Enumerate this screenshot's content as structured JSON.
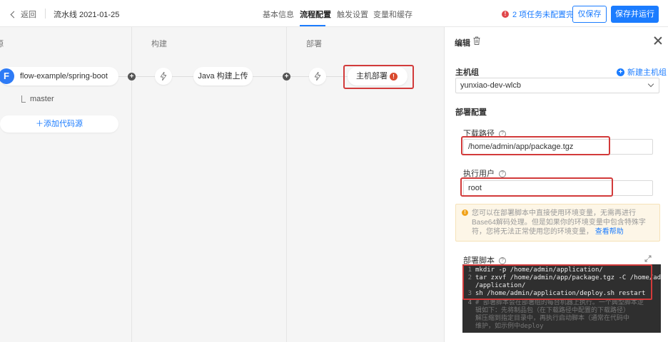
{
  "header": {
    "back_label": "返回",
    "pipeline_title": "流水线 2021-01-25",
    "tabs": [
      {
        "label": "基本信息",
        "active": false
      },
      {
        "label": "流程配置",
        "active": true
      },
      {
        "label": "触发设置",
        "active": false
      },
      {
        "label": "变量和缓存",
        "active": false
      }
    ],
    "warning_count": "!",
    "warning_text": "2 项任务未配置完",
    "save_label": "仅保存",
    "save_run_label": "保存并运行"
  },
  "canvas": {
    "stages": [
      {
        "label": "源"
      },
      {
        "label": "构建"
      },
      {
        "label": "部署"
      }
    ],
    "source": {
      "icon": "F",
      "repo": "flow-example/spring-boot",
      "branch": "master",
      "add_label": "＋添加代码源"
    },
    "build_task": "Java 构建上传",
    "deploy_task": "主机部署",
    "deploy_error": "!"
  },
  "panel": {
    "title": "编辑",
    "host_group_label": "主机组",
    "new_host_label": "新建主机组",
    "host_group_value": "yunxiao-dev-wlcb",
    "deploy_config_label": "部署配置",
    "download_path_label": "下载路径",
    "download_path_value": "/home/admin/app/package.tgz",
    "exec_user_label": "执行用户",
    "exec_user_value": "root",
    "notice_text": "您可以在部署脚本中直接使用环境变量，无需再进行Base64解码处理。但是如果你的环境变量中包含特殊字符，您将无法正常使用您的环境变量，",
    "notice_link": "查看帮助",
    "script_label": "部署脚本",
    "script_lines": [
      {
        "n": "1",
        "text": "mkdir -p /home/admin/application/"
      },
      {
        "n": "2",
        "text": "tar zxvf /home/admin/app/package.tgz -C /home/admin"
      },
      {
        "n": "",
        "text": "    /application/"
      },
      {
        "n": "3",
        "text": "sh /home/admin/application/deploy.sh restart"
      },
      {
        "n": "4",
        "text": "# 部署脚本会在部署组的每台机器上执行。一个典型脚本逻"
      },
      {
        "n": "",
        "text": "    辑如下：先将制品包（在下载路径中配置的下载路径）"
      },
      {
        "n": "",
        "text": "    解压缩到指定目录中，再执行启动脚本（通常在代码中"
      },
      {
        "n": "",
        "text": "    维护，如示例中deploy"
      }
    ]
  },
  "colors": {
    "primary": "#1b7cff",
    "highlight": "#d23a3a",
    "error": "#e0464a"
  }
}
